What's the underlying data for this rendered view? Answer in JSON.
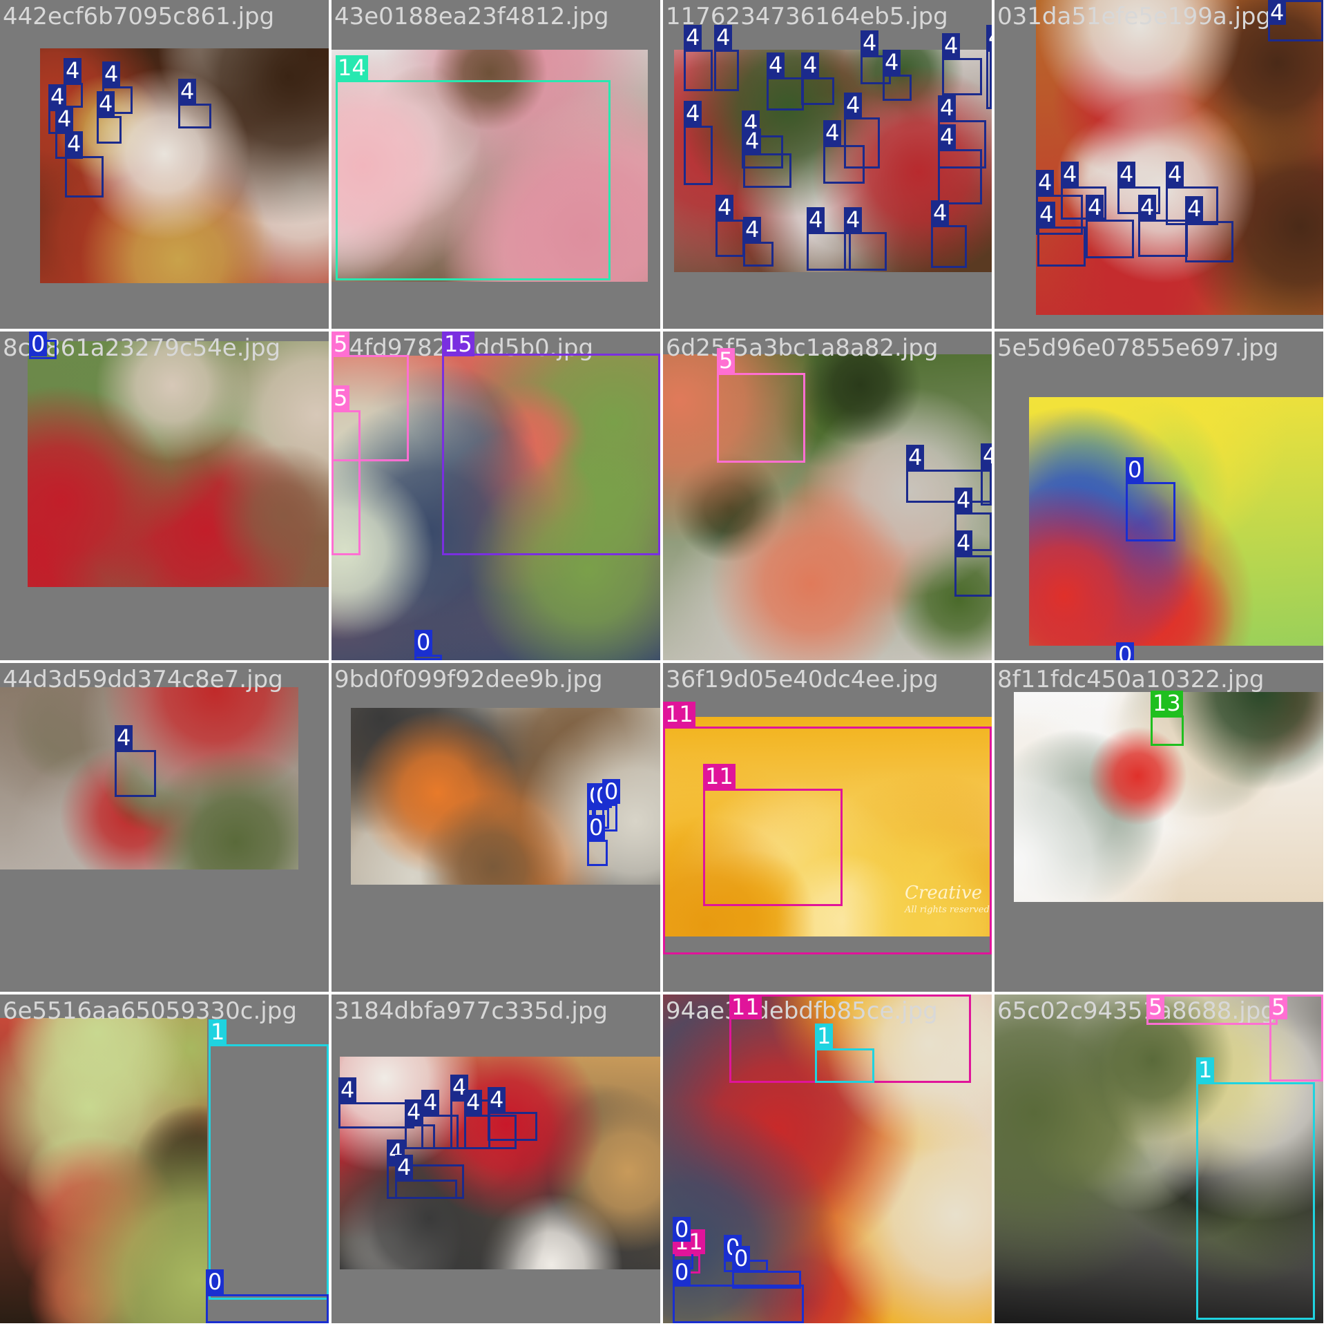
{
  "colors": {
    "tile_background": "#7a7a7a",
    "filename_text": "#d8d8d8",
    "grid_gap": "#ffffff",
    "classes": {
      "0": "#1a2fd0",
      "1": "#1fd3e0",
      "4": "#1b2a8c",
      "5": "#ff6fd2",
      "11": "#e0149a",
      "13": "#1fbf1f",
      "14": "#27e8b0",
      "15": "#7a2fe0"
    }
  },
  "tiles": [
    {
      "filename": "442ecf6b7095c861.jpg",
      "photo": {
        "subject": "breakfast plate with fruit, muffin and bacon",
        "colors": [
          "#3a2414",
          "#e9e4dc",
          "#c9a24a",
          "#b23a24"
        ]
      },
      "boxes": [
        {
          "label": "4"
        },
        {
          "label": "4"
        },
        {
          "label": "4"
        },
        {
          "label": "4"
        },
        {
          "label": "4"
        },
        {
          "label": "4"
        },
        {
          "label": "4"
        }
      ]
    },
    {
      "filename": "43e0188ea23f4812.jpg",
      "photo": {
        "subject": "pink pomegranate close-up with QR code",
        "colors": [
          "#e8e8e8",
          "#f1b6bd",
          "#dd8f9e",
          "#6e5138"
        ]
      },
      "boxes": [
        {
          "label": "14"
        }
      ]
    },
    {
      "filename": "1176234736164eb5.jpg",
      "photo": {
        "subject": "strawberries in white cups on wooden tray",
        "colors": [
          "#e8e8e8",
          "#b82a2e",
          "#3a5a2a",
          "#5a3a22"
        ]
      },
      "boxes": [
        {
          "label": "4"
        },
        {
          "label": "4"
        },
        {
          "label": "4"
        },
        {
          "label": "4"
        },
        {
          "label": "4"
        },
        {
          "label": "4"
        },
        {
          "label": "4"
        },
        {
          "label": "4"
        },
        {
          "label": "4"
        },
        {
          "label": "4"
        },
        {
          "label": "4"
        },
        {
          "label": "4"
        },
        {
          "label": "4"
        },
        {
          "label": "4"
        },
        {
          "label": "4"
        },
        {
          "label": "4"
        },
        {
          "label": "4"
        },
        {
          "label": "4"
        },
        {
          "label": "4"
        },
        {
          "label": "4"
        }
      ]
    },
    {
      "filename": "031da51efe5e199a.jpg",
      "photo": {
        "subject": "halloween chocolate treats and dipped strawberries",
        "colors": [
          "#b86a2a",
          "#e6e2dc",
          "#4a2a18",
          "#c42a2e"
        ]
      },
      "boxes": [
        {
          "label": "4"
        },
        {
          "label": "4"
        },
        {
          "label": "4"
        },
        {
          "label": "4"
        },
        {
          "label": "4"
        },
        {
          "label": "4"
        },
        {
          "label": "4"
        },
        {
          "label": "4"
        },
        {
          "label": "4"
        }
      ]
    },
    {
      "filename": "8c1861a23279c54e.jpg",
      "photo": {
        "subject": "small red apples on a branch",
        "colors": [
          "#6b8a4a",
          "#c21e2a",
          "#d7c8b8",
          "#8a5a42"
        ]
      },
      "boxes": [
        {
          "label": "0"
        }
      ]
    },
    {
      "filename": "54fd97821cdd5b0.jpg",
      "photo": {
        "subject": "watermelon slices, green apples and seafood market",
        "colors": [
          "#e06a5a",
          "#7aa04a",
          "#d8e0c8",
          "#3a4a6a"
        ]
      },
      "boxes": [
        {
          "label": "5"
        },
        {
          "label": "5"
        },
        {
          "label": "15"
        },
        {
          "label": "0"
        }
      ]
    },
    {
      "filename": "6d25f5a3bc1a8a82.jpg",
      "photo": {
        "subject": "rose hips on a bush with food plate",
        "colors": [
          "#4a6a2a",
          "#e07a5a",
          "#2a3a1a",
          "#c8c4bc"
        ]
      },
      "boxes": [
        {
          "label": "5"
        },
        {
          "label": "4"
        },
        {
          "label": "4"
        },
        {
          "label": "4"
        },
        {
          "label": "4"
        }
      ]
    },
    {
      "filename": "5e5d96e07855e697.jpg",
      "photo": {
        "subject": "painting of fruit bowl on red table",
        "colors": [
          "#f2e23a",
          "#e0302a",
          "#2a4ac8",
          "#9ad05a"
        ]
      },
      "boxes": [
        {
          "label": "0"
        },
        {
          "label": "0"
        }
      ]
    },
    {
      "filename": "44d3d59dd374c8e7.jpg",
      "photo": {
        "subject": "blurred strawberry on mossy rock",
        "colors": [
          "#8a7a6a",
          "#5a6a3a",
          "#c02a2a",
          "#b8b0a8"
        ]
      },
      "boxes": [
        {
          "label": "4"
        }
      ]
    },
    {
      "filename": "9bd0f099f92dee9b.jpg",
      "photo": {
        "subject": "bakery shop interior with oranges",
        "colors": [
          "#d8d4c8",
          "#7a5a3a",
          "#e87a2a",
          "#3a3a3a"
        ]
      },
      "boxes": [
        {
          "label": "0"
        },
        {
          "label": "0"
        },
        {
          "label": "0"
        },
        {
          "label": "0"
        }
      ]
    },
    {
      "filename": "36f19d05e40dc4ee.jpg",
      "photo": {
        "subject": "diced mango close-up",
        "colors": [
          "#f2b21a",
          "#e89a10",
          "#f6cf4a",
          "#fbe6a0"
        ]
      },
      "watermark": "Creative",
      "watermark_sub": "All rights reserved",
      "boxes": [
        {
          "label": "11"
        },
        {
          "label": "11"
        }
      ]
    },
    {
      "filename": "8f11fdc450a10322.jpg",
      "photo": {
        "subject": "new year decoration with orange",
        "colors": [
          "#e8d8c0",
          "#2a4a2a",
          "#e0302a",
          "#f8f8f8"
        ]
      },
      "boxes": [
        {
          "label": "13"
        }
      ]
    },
    {
      "filename": "6e5516aa65059330c.jpg",
      "photo": {
        "subject": "meat dish with green grapes and apple",
        "colors": [
          "#2a1e14",
          "#c8d890",
          "#a8b860",
          "#c84a3a"
        ]
      },
      "boxes": [
        {
          "label": "1"
        },
        {
          "label": "0"
        }
      ]
    },
    {
      "filename": "3184dbfa977c335d.jpg",
      "photo": {
        "subject": "bowl of yogurt with strawberries and a cookie",
        "colors": [
          "#3a3a3a",
          "#f0ece6",
          "#c8182a",
          "#c89a5a"
        ]
      },
      "boxes": [
        {
          "label": "4"
        },
        {
          "label": "4"
        },
        {
          "label": "4"
        },
        {
          "label": "4"
        },
        {
          "label": "4"
        },
        {
          "label": "4"
        },
        {
          "label": "4"
        },
        {
          "label": "4"
        }
      ]
    },
    {
      "filename": "94ae37debdfb85ce.jpg",
      "photo": {
        "subject": "mango cubes and seafood market vendor with apples",
        "colors": [
          "#f2b21a",
          "#e8e0cc",
          "#3a4a6a",
          "#c82a2a"
        ]
      },
      "boxes": [
        {
          "label": "11"
        },
        {
          "label": "1"
        },
        {
          "label": "11"
        },
        {
          "label": "0"
        },
        {
          "label": "0"
        },
        {
          "label": "0"
        },
        {
          "label": "0"
        }
      ]
    },
    {
      "filename": "65c02c94351a8688.jpg",
      "photo": {
        "subject": "interior with chair, green apple and grape vine",
        "colors": [
          "#1a1a1a",
          "#5a6a3a",
          "#d8d08a",
          "#e8e4dc"
        ]
      },
      "boxes": [
        {
          "label": "5"
        },
        {
          "label": "5"
        },
        {
          "label": "1"
        }
      ]
    }
  ]
}
